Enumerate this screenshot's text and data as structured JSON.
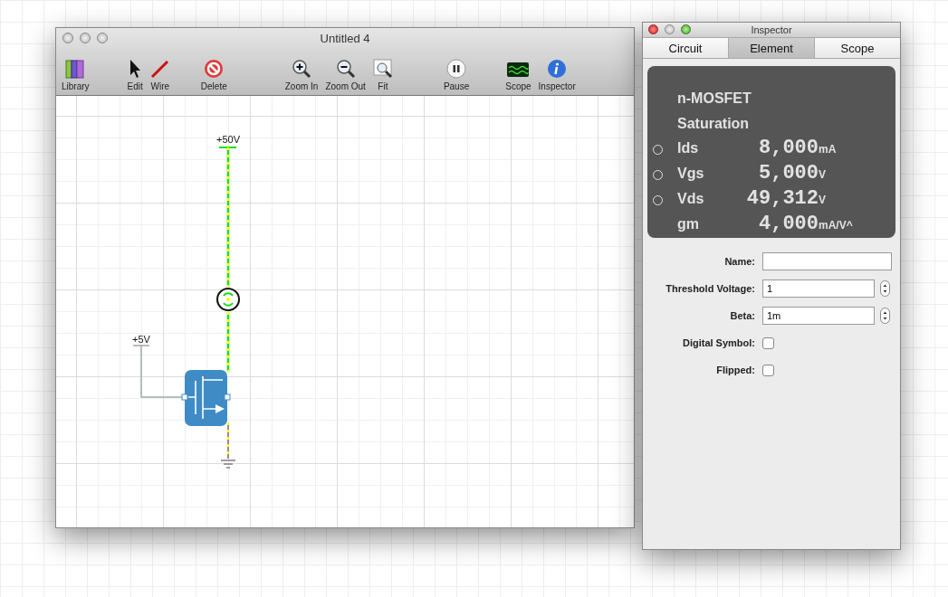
{
  "main_window": {
    "title": "Untitled 4",
    "toolbar": [
      {
        "items": [
          "Library"
        ]
      },
      {
        "items": [
          "Edit",
          "Wire"
        ]
      },
      {
        "items": [
          "Delete"
        ]
      },
      {
        "items": [
          "Zoom In",
          "Zoom Out",
          "Fit"
        ]
      },
      {
        "items": [
          "Pause"
        ]
      },
      {
        "items": [
          "Scope",
          "Inspector"
        ]
      }
    ],
    "circuit": {
      "supply_label": "+50V",
      "gate_label": "+5V"
    }
  },
  "inspector": {
    "title": "Inspector",
    "tabs": [
      {
        "label": "Circuit",
        "selected": false
      },
      {
        "label": "Element",
        "selected": true
      },
      {
        "label": "Scope",
        "selected": false
      }
    ],
    "display": {
      "title": "n-MOSFET",
      "state": "Saturation",
      "readings": [
        {
          "kind": "probe",
          "selected": false,
          "name": "Ids",
          "value": "8,000",
          "unit": "mA"
        },
        {
          "kind": "probe",
          "selected": false,
          "name": "Vgs",
          "value": "5,000",
          "unit": "V"
        },
        {
          "kind": "probe",
          "selected": false,
          "name": "Vds",
          "value": "49,312",
          "unit": "V"
        },
        {
          "kind": "plain",
          "name": "gm",
          "value": "4,000",
          "unit": "mA/V^"
        }
      ]
    },
    "fields": [
      {
        "kind": "text",
        "label": "Name:"
      },
      {
        "kind": "stepper",
        "label": "Threshold Voltage:",
        "value": "1"
      },
      {
        "kind": "stepper",
        "label": "Beta:",
        "value": "1m"
      },
      {
        "kind": "checkbox",
        "label": "Digital Symbol:",
        "checked": false
      },
      {
        "kind": "checkbox",
        "label": "Flipped:",
        "checked": false
      }
    ]
  }
}
